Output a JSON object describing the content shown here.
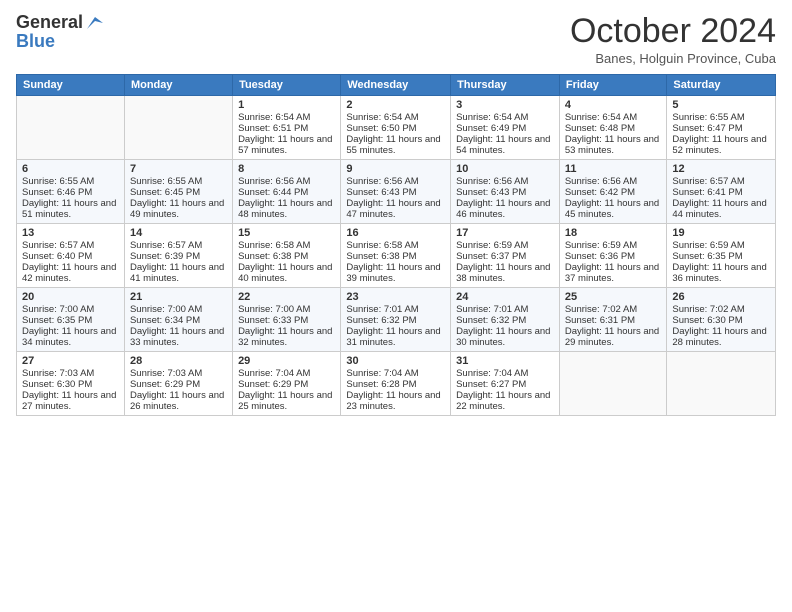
{
  "logo": {
    "general": "General",
    "blue": "Blue"
  },
  "header": {
    "month": "October 2024",
    "location": "Banes, Holguin Province, Cuba"
  },
  "weekdays": [
    "Sunday",
    "Monday",
    "Tuesday",
    "Wednesday",
    "Thursday",
    "Friday",
    "Saturday"
  ],
  "weeks": [
    [
      {
        "day": "",
        "sunrise": "",
        "sunset": "",
        "daylight": ""
      },
      {
        "day": "",
        "sunrise": "",
        "sunset": "",
        "daylight": ""
      },
      {
        "day": "1",
        "sunrise": "Sunrise: 6:54 AM",
        "sunset": "Sunset: 6:51 PM",
        "daylight": "Daylight: 11 hours and 57 minutes."
      },
      {
        "day": "2",
        "sunrise": "Sunrise: 6:54 AM",
        "sunset": "Sunset: 6:50 PM",
        "daylight": "Daylight: 11 hours and 55 minutes."
      },
      {
        "day": "3",
        "sunrise": "Sunrise: 6:54 AM",
        "sunset": "Sunset: 6:49 PM",
        "daylight": "Daylight: 11 hours and 54 minutes."
      },
      {
        "day": "4",
        "sunrise": "Sunrise: 6:54 AM",
        "sunset": "Sunset: 6:48 PM",
        "daylight": "Daylight: 11 hours and 53 minutes."
      },
      {
        "day": "5",
        "sunrise": "Sunrise: 6:55 AM",
        "sunset": "Sunset: 6:47 PM",
        "daylight": "Daylight: 11 hours and 52 minutes."
      }
    ],
    [
      {
        "day": "6",
        "sunrise": "Sunrise: 6:55 AM",
        "sunset": "Sunset: 6:46 PM",
        "daylight": "Daylight: 11 hours and 51 minutes."
      },
      {
        "day": "7",
        "sunrise": "Sunrise: 6:55 AM",
        "sunset": "Sunset: 6:45 PM",
        "daylight": "Daylight: 11 hours and 49 minutes."
      },
      {
        "day": "8",
        "sunrise": "Sunrise: 6:56 AM",
        "sunset": "Sunset: 6:44 PM",
        "daylight": "Daylight: 11 hours and 48 minutes."
      },
      {
        "day": "9",
        "sunrise": "Sunrise: 6:56 AM",
        "sunset": "Sunset: 6:43 PM",
        "daylight": "Daylight: 11 hours and 47 minutes."
      },
      {
        "day": "10",
        "sunrise": "Sunrise: 6:56 AM",
        "sunset": "Sunset: 6:43 PM",
        "daylight": "Daylight: 11 hours and 46 minutes."
      },
      {
        "day": "11",
        "sunrise": "Sunrise: 6:56 AM",
        "sunset": "Sunset: 6:42 PM",
        "daylight": "Daylight: 11 hours and 45 minutes."
      },
      {
        "day": "12",
        "sunrise": "Sunrise: 6:57 AM",
        "sunset": "Sunset: 6:41 PM",
        "daylight": "Daylight: 11 hours and 44 minutes."
      }
    ],
    [
      {
        "day": "13",
        "sunrise": "Sunrise: 6:57 AM",
        "sunset": "Sunset: 6:40 PM",
        "daylight": "Daylight: 11 hours and 42 minutes."
      },
      {
        "day": "14",
        "sunrise": "Sunrise: 6:57 AM",
        "sunset": "Sunset: 6:39 PM",
        "daylight": "Daylight: 11 hours and 41 minutes."
      },
      {
        "day": "15",
        "sunrise": "Sunrise: 6:58 AM",
        "sunset": "Sunset: 6:38 PM",
        "daylight": "Daylight: 11 hours and 40 minutes."
      },
      {
        "day": "16",
        "sunrise": "Sunrise: 6:58 AM",
        "sunset": "Sunset: 6:38 PM",
        "daylight": "Daylight: 11 hours and 39 minutes."
      },
      {
        "day": "17",
        "sunrise": "Sunrise: 6:59 AM",
        "sunset": "Sunset: 6:37 PM",
        "daylight": "Daylight: 11 hours and 38 minutes."
      },
      {
        "day": "18",
        "sunrise": "Sunrise: 6:59 AM",
        "sunset": "Sunset: 6:36 PM",
        "daylight": "Daylight: 11 hours and 37 minutes."
      },
      {
        "day": "19",
        "sunrise": "Sunrise: 6:59 AM",
        "sunset": "Sunset: 6:35 PM",
        "daylight": "Daylight: 11 hours and 36 minutes."
      }
    ],
    [
      {
        "day": "20",
        "sunrise": "Sunrise: 7:00 AM",
        "sunset": "Sunset: 6:35 PM",
        "daylight": "Daylight: 11 hours and 34 minutes."
      },
      {
        "day": "21",
        "sunrise": "Sunrise: 7:00 AM",
        "sunset": "Sunset: 6:34 PM",
        "daylight": "Daylight: 11 hours and 33 minutes."
      },
      {
        "day": "22",
        "sunrise": "Sunrise: 7:00 AM",
        "sunset": "Sunset: 6:33 PM",
        "daylight": "Daylight: 11 hours and 32 minutes."
      },
      {
        "day": "23",
        "sunrise": "Sunrise: 7:01 AM",
        "sunset": "Sunset: 6:32 PM",
        "daylight": "Daylight: 11 hours and 31 minutes."
      },
      {
        "day": "24",
        "sunrise": "Sunrise: 7:01 AM",
        "sunset": "Sunset: 6:32 PM",
        "daylight": "Daylight: 11 hours and 30 minutes."
      },
      {
        "day": "25",
        "sunrise": "Sunrise: 7:02 AM",
        "sunset": "Sunset: 6:31 PM",
        "daylight": "Daylight: 11 hours and 29 minutes."
      },
      {
        "day": "26",
        "sunrise": "Sunrise: 7:02 AM",
        "sunset": "Sunset: 6:30 PM",
        "daylight": "Daylight: 11 hours and 28 minutes."
      }
    ],
    [
      {
        "day": "27",
        "sunrise": "Sunrise: 7:03 AM",
        "sunset": "Sunset: 6:30 PM",
        "daylight": "Daylight: 11 hours and 27 minutes."
      },
      {
        "day": "28",
        "sunrise": "Sunrise: 7:03 AM",
        "sunset": "Sunset: 6:29 PM",
        "daylight": "Daylight: 11 hours and 26 minutes."
      },
      {
        "day": "29",
        "sunrise": "Sunrise: 7:04 AM",
        "sunset": "Sunset: 6:29 PM",
        "daylight": "Daylight: 11 hours and 25 minutes."
      },
      {
        "day": "30",
        "sunrise": "Sunrise: 7:04 AM",
        "sunset": "Sunset: 6:28 PM",
        "daylight": "Daylight: 11 hours and 23 minutes."
      },
      {
        "day": "31",
        "sunrise": "Sunrise: 7:04 AM",
        "sunset": "Sunset: 6:27 PM",
        "daylight": "Daylight: 11 hours and 22 minutes."
      },
      {
        "day": "",
        "sunrise": "",
        "sunset": "",
        "daylight": ""
      },
      {
        "day": "",
        "sunrise": "",
        "sunset": "",
        "daylight": ""
      }
    ]
  ]
}
